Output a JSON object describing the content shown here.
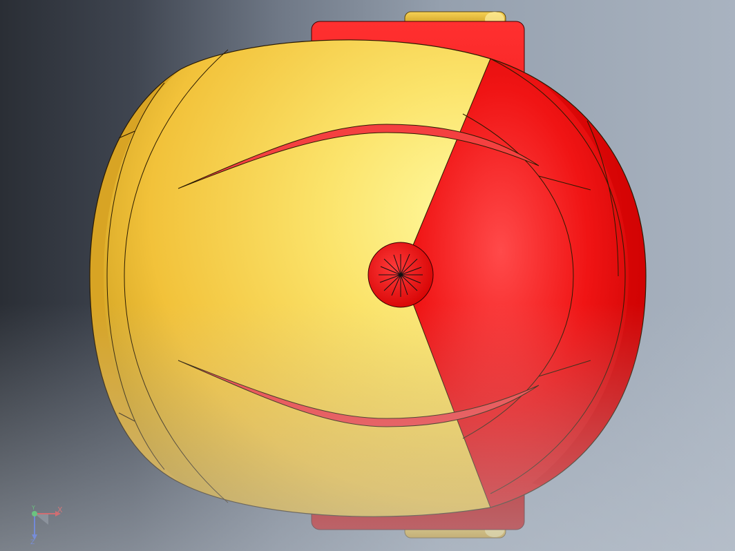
{
  "viewport": {
    "background_colors": [
      "#2a2e35",
      "#6f7886",
      "#a9b3c0"
    ]
  },
  "model": {
    "shell_color": "#f2c23a",
    "shell_highlight": "#fff9a0",
    "cap_color": "#ee1111",
    "cap_highlight": "#ff4040",
    "hinge_color": "#e3b42e"
  },
  "triad": {
    "x_label": "X",
    "y_label": "Y",
    "z_label": "Z",
    "x_color": "#e02020",
    "y_color": "#22c03a",
    "z_color": "#2a4fe0"
  }
}
